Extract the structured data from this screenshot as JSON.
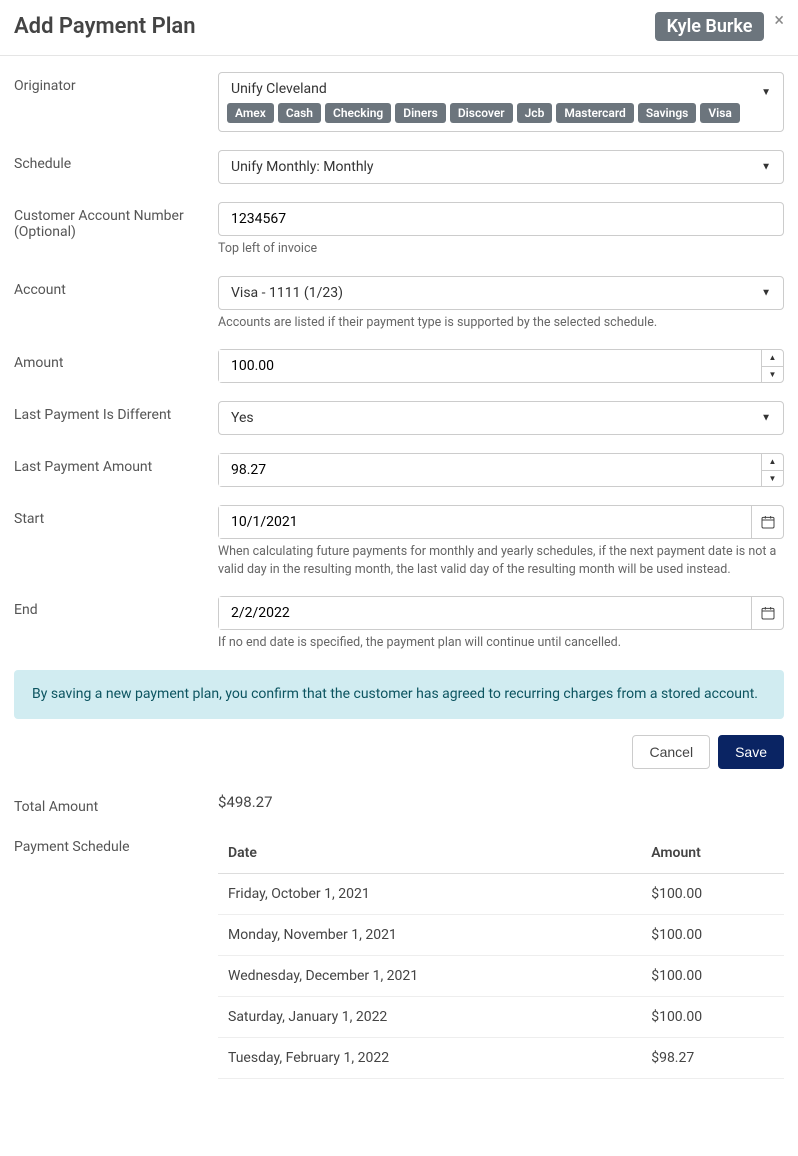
{
  "header": {
    "title": "Add Payment Plan",
    "user": "Kyle Burke"
  },
  "form": {
    "originator": {
      "label": "Originator",
      "value": "Unify Cleveland",
      "badges": [
        "Amex",
        "Cash",
        "Checking",
        "Diners",
        "Discover",
        "Jcb",
        "Mastercard",
        "Savings",
        "Visa"
      ]
    },
    "schedule": {
      "label": "Schedule",
      "value": "Unify Monthly: Monthly"
    },
    "customerAccount": {
      "label": "Customer Account Number (Optional)",
      "value": "1234567",
      "helper": "Top left of invoice"
    },
    "account": {
      "label": "Account",
      "value": "Visa - 1111 (1/23)",
      "helper": "Accounts are listed if their payment type is supported by the selected schedule."
    },
    "amount": {
      "label": "Amount",
      "value": "100.00"
    },
    "lastDifferent": {
      "label": "Last Payment Is Different",
      "value": "Yes"
    },
    "lastAmount": {
      "label": "Last Payment Amount",
      "value": "98.27"
    },
    "start": {
      "label": "Start",
      "value": "10/1/2021",
      "helper": "When calculating future payments for monthly and yearly schedules, if the next payment date is not a valid day in the resulting month, the last valid day of the resulting month will be used instead."
    },
    "end": {
      "label": "End",
      "value": "2/2/2022",
      "helper": "If no end date is specified, the payment plan will continue until cancelled."
    }
  },
  "alert": "By saving a new payment plan, you confirm that the customer has agreed to recurring charges from a stored account.",
  "buttons": {
    "cancel": "Cancel",
    "save": "Save"
  },
  "total": {
    "label": "Total Amount",
    "value": "$498.27"
  },
  "scheduleTable": {
    "label": "Payment Schedule",
    "headers": {
      "date": "Date",
      "amount": "Amount"
    },
    "rows": [
      {
        "date": "Friday, October 1, 2021",
        "amount": "$100.00"
      },
      {
        "date": "Monday, November 1, 2021",
        "amount": "$100.00"
      },
      {
        "date": "Wednesday, December 1, 2021",
        "amount": "$100.00"
      },
      {
        "date": "Saturday, January 1, 2022",
        "amount": "$100.00"
      },
      {
        "date": "Tuesday, February 1, 2022",
        "amount": "$98.27"
      }
    ]
  }
}
